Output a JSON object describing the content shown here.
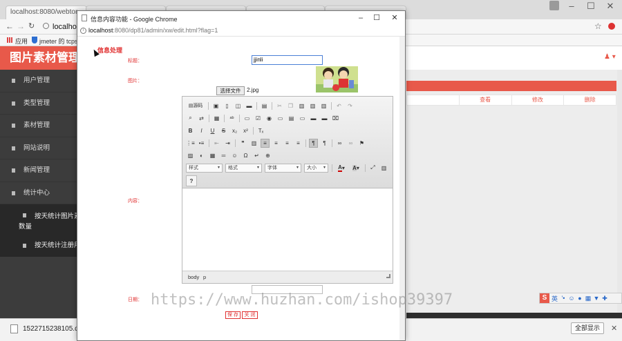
{
  "background_browser": {
    "tabs": [
      {
        "label": "localhost:8080/webtor"
      },
      {
        "label": ""
      },
      {
        "label": ""
      },
      {
        "label": ""
      },
      {
        "label": ""
      }
    ],
    "address": "localhost:8",
    "bookmarks": {
      "apps_label": "应用",
      "bookmark_1": "jmeter 的 tcpsam"
    }
  },
  "app": {
    "logo_title": "图片素材管理系",
    "sidebar": [
      {
        "label": "用户管理"
      },
      {
        "label": "类型管理"
      },
      {
        "label": "素材管理"
      },
      {
        "label": "网站说明"
      },
      {
        "label": "新闻管理"
      },
      {
        "label": "统计中心"
      }
    ],
    "sidebar_sub": [
      {
        "label": "按天统计图片素材",
        "label2": "数量"
      },
      {
        "label": "按天统计注册用户"
      }
    ],
    "table_headers": [
      "",
      "查看",
      "修改",
      "删除"
    ]
  },
  "popup": {
    "title": "信息内容功能 - Google Chrome",
    "url_host": "localhost",
    "url_path": ":8080/dp81/admin/xw/edit.html?flag=1",
    "heading": "信息处理",
    "title_label": "标题：",
    "title_value": "jjinli",
    "image_label": "图片：",
    "choose_file_label": "选择文件",
    "chosen_file": "2.jpg",
    "content_label": "内容：",
    "date_label": "日期：",
    "save_label": "保 存",
    "close_label": "关 闭",
    "editor": {
      "source_label": "源码",
      "combo_styles": "样式",
      "combo_format": "格式",
      "combo_font": "字体",
      "combo_size": "大小",
      "help_label": "?",
      "status_path_1": "body",
      "status_path_2": "p"
    }
  },
  "download": {
    "filename": "1522715238105.doc",
    "show_all": "全部显示"
  },
  "ime": {
    "label": "英"
  },
  "watermark": "https://www.huzhan.com/ishop39397"
}
